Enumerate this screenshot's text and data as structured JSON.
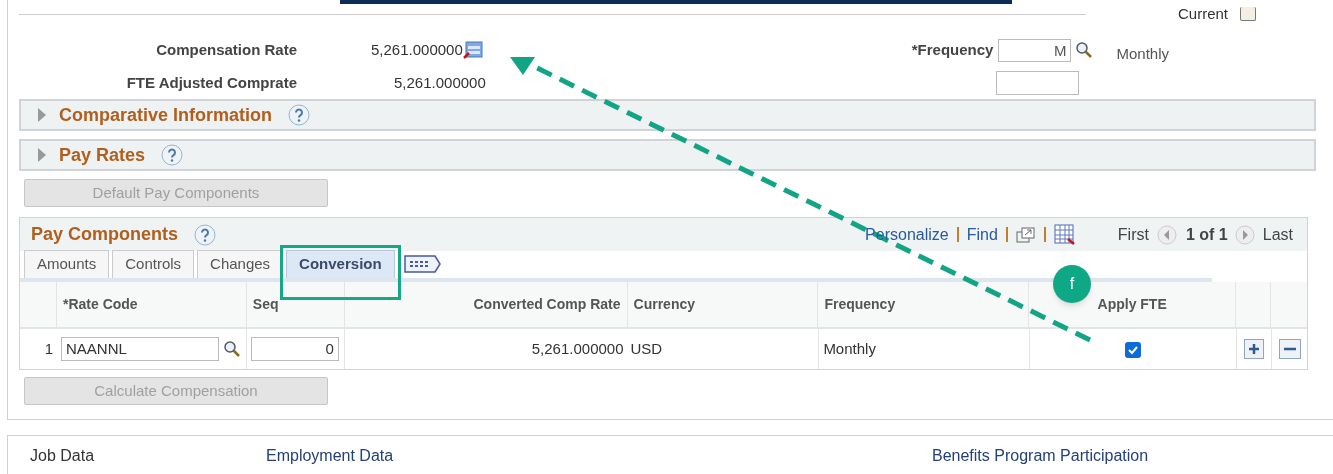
{
  "current": {
    "label": "Current",
    "checked": false
  },
  "fields": [
    {
      "label": "Compensation Rate",
      "value": "5,261.000000"
    },
    {
      "label": "FTE Adjusted Comprate",
      "value": "5,261.000000"
    }
  ],
  "frequency": {
    "label": "*Frequency",
    "value": "M",
    "description": "Monthly"
  },
  "sections": [
    {
      "title": "Comparative Information",
      "expanded": false
    },
    {
      "title": "Pay Rates",
      "expanded": false
    }
  ],
  "default_button": {
    "label": "Default Pay Components",
    "disabled": true
  },
  "pay_components": {
    "title": "Pay Components",
    "toolbar": [
      "Personalize",
      "Find"
    ],
    "nav": {
      "first": "First",
      "count": "1 of 1",
      "last": "Last"
    },
    "tabs": [
      {
        "label": "Amounts",
        "selected": false
      },
      {
        "label": "Controls",
        "selected": false
      },
      {
        "label": "Changes",
        "selected": false
      },
      {
        "label": "Conversion",
        "selected": true
      }
    ],
    "columns": [
      "*Rate Code",
      "Seq",
      "Converted Comp Rate",
      "Currency",
      "Frequency",
      "Apply FTE"
    ],
    "rows": [
      {
        "number": "1",
        "rate_code": "NAANNL",
        "seq": "0",
        "converted": "5,261.000000",
        "currency": "USD",
        "frequency": "Monthly",
        "apply_fte": true
      }
    ]
  },
  "calculate_button": {
    "label": "Calculate Compensation",
    "disabled": true
  },
  "annotation": {
    "badge": "f"
  },
  "footer_links": [
    "Job Data",
    "Employment Data",
    "Benefits Program Participation"
  ]
}
